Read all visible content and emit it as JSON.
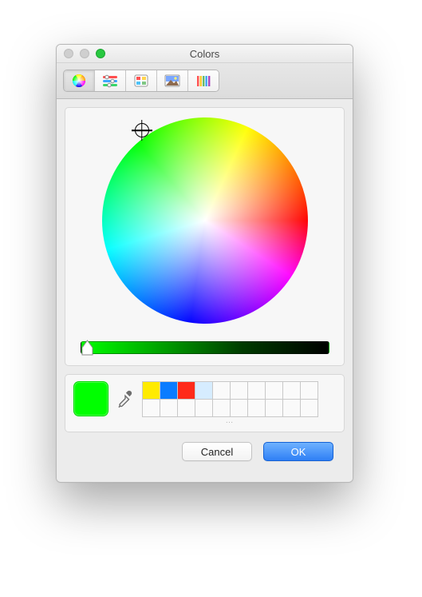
{
  "window": {
    "title": "Colors"
  },
  "toolbar": {
    "modes": [
      {
        "id": "wheel",
        "name": "Color Wheel",
        "selected": true
      },
      {
        "id": "sliders",
        "name": "Color Sliders",
        "selected": false
      },
      {
        "id": "palettes",
        "name": "Color Palettes",
        "selected": false
      },
      {
        "id": "image",
        "name": "Image Palettes",
        "selected": false
      },
      {
        "id": "pencils",
        "name": "Pencils",
        "selected": false
      }
    ]
  },
  "selected_color": {
    "hex": "#00FF00",
    "name": "green"
  },
  "brightness": {
    "value": 100,
    "track_from": "#00FF00",
    "track_to": "#000000"
  },
  "swatches": {
    "rows": 2,
    "cols": 10,
    "cells": [
      "#FFEB00",
      "#0A7CFF",
      "#FF2A1A",
      "#D6ECFF",
      null,
      null,
      null,
      null,
      null,
      null,
      null,
      null,
      null,
      null,
      null,
      null,
      null,
      null,
      null,
      null
    ]
  },
  "buttons": {
    "cancel": "Cancel",
    "ok": "OK"
  }
}
